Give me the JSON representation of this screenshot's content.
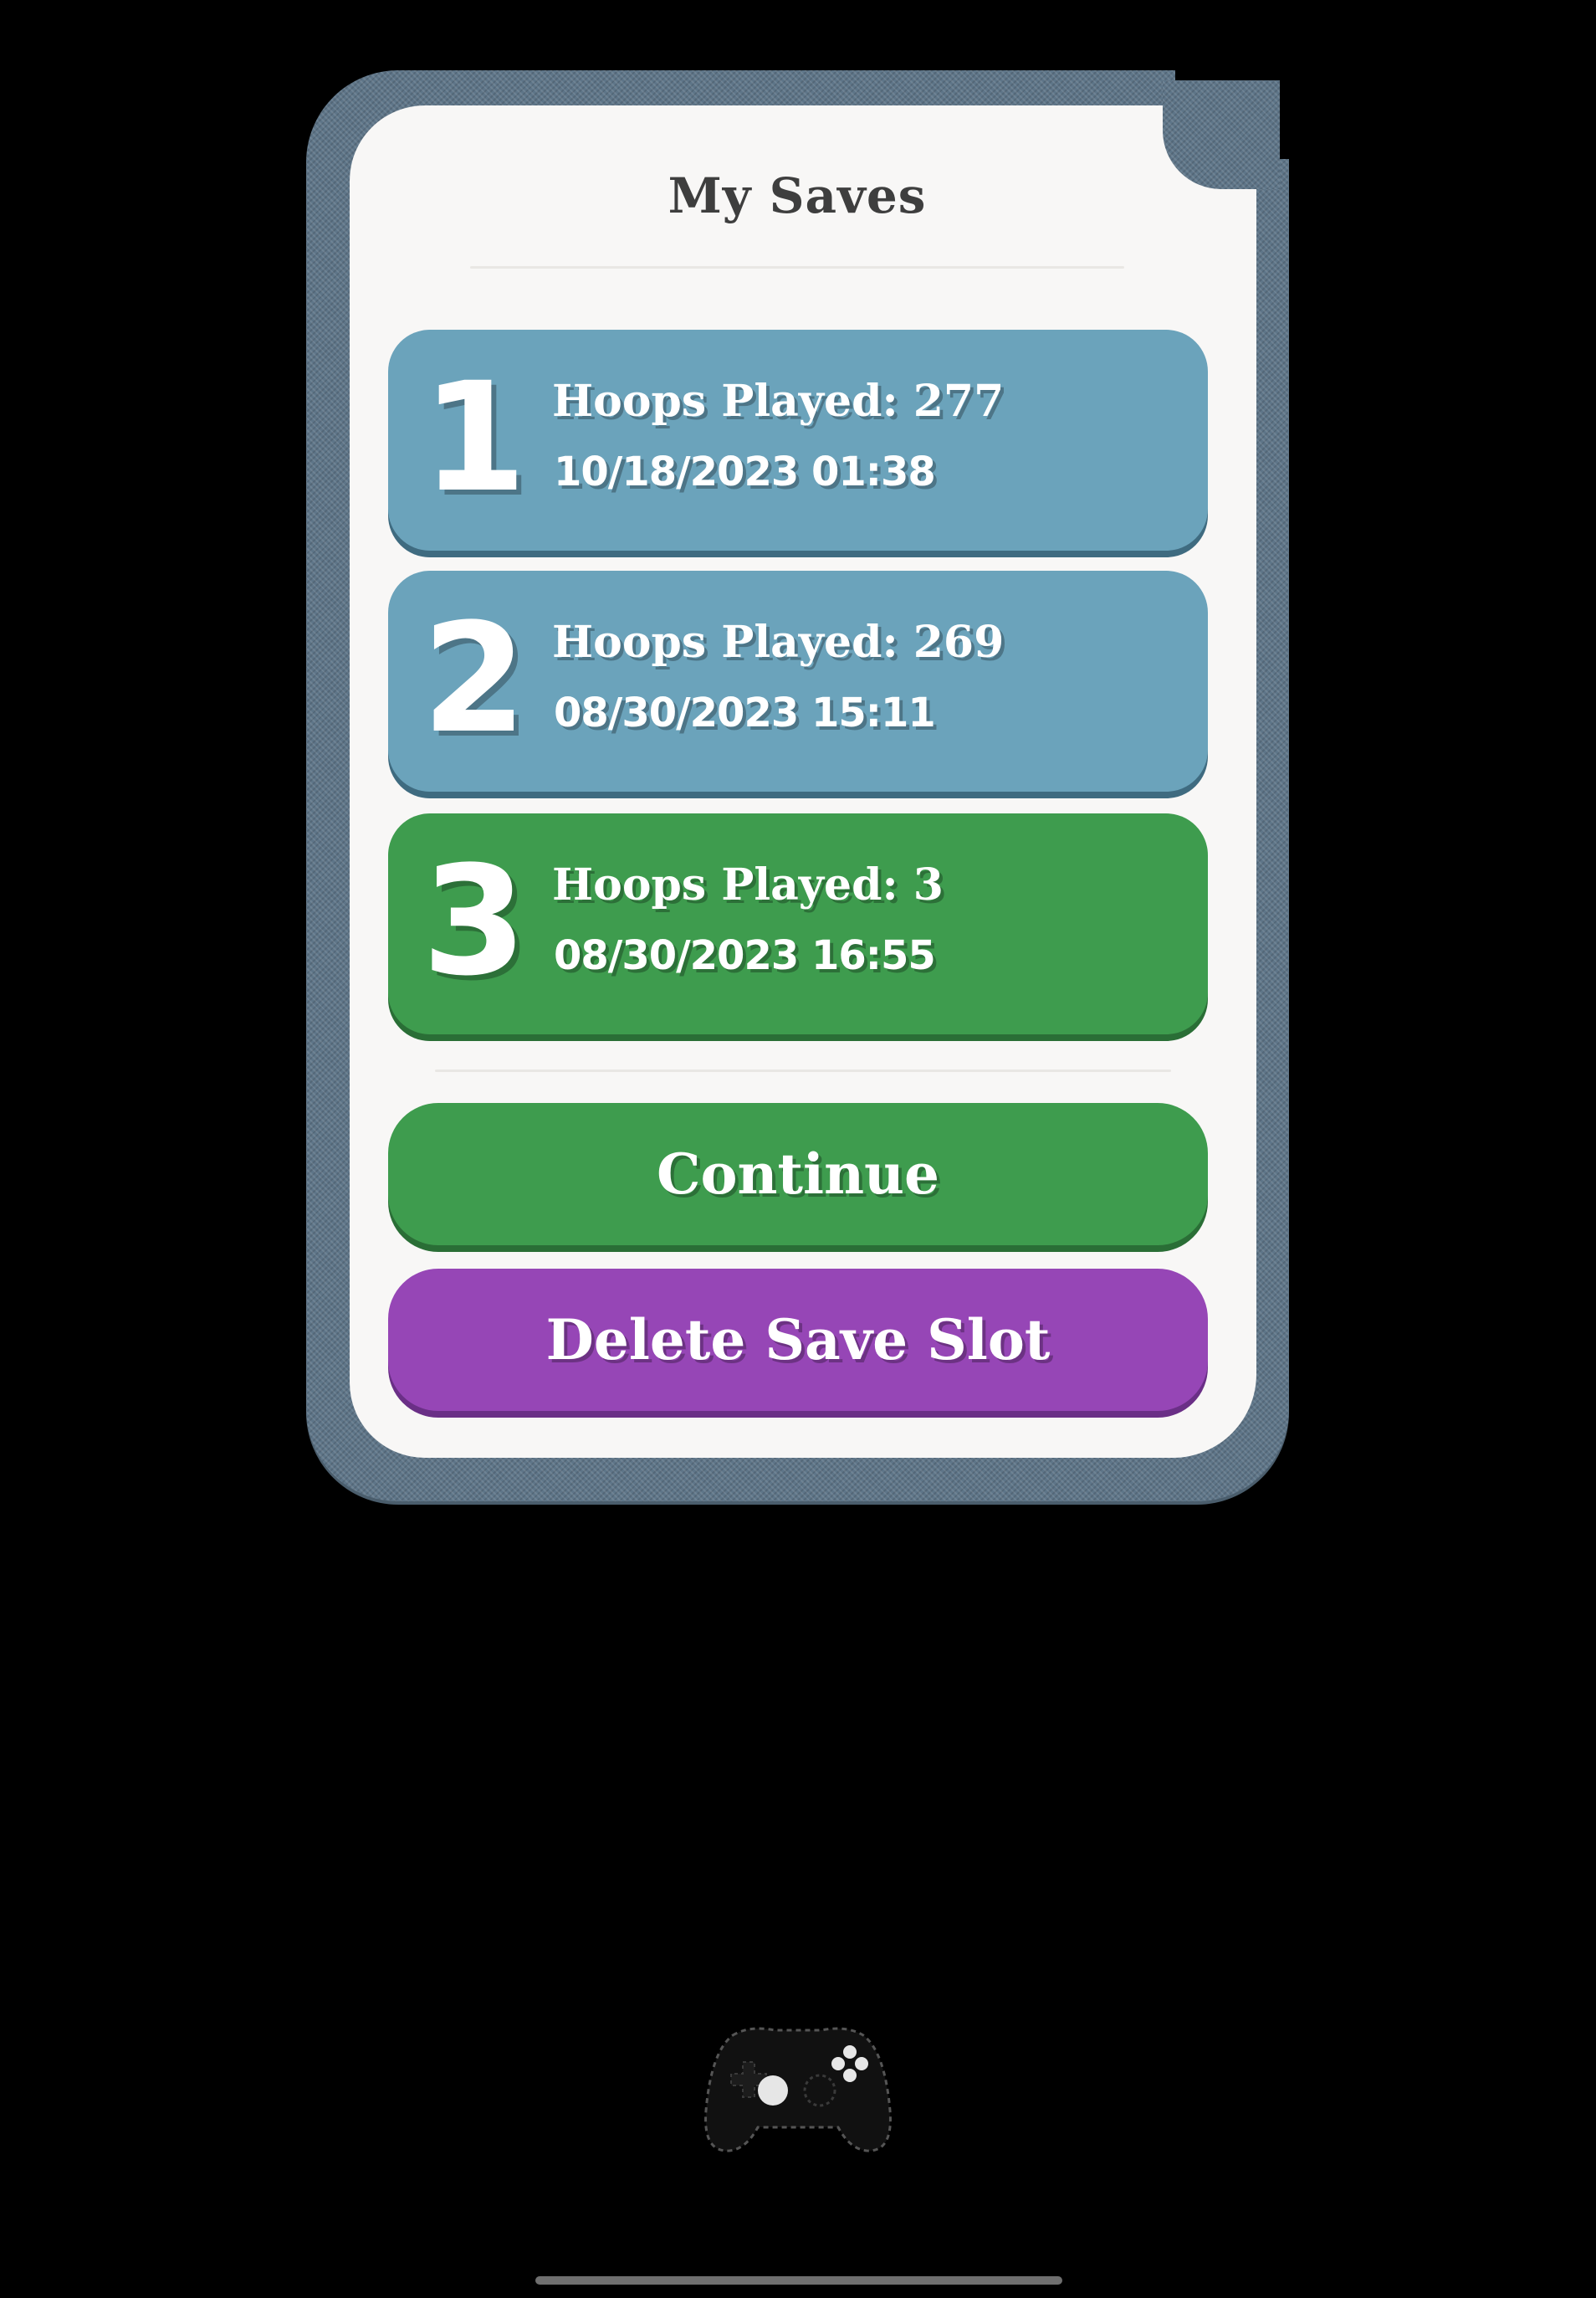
{
  "dialog": {
    "title": "My Saves"
  },
  "slots": [
    {
      "number": "1",
      "hoops": "Hoops Played: 277",
      "date": "10/18/2023 01:38",
      "color": "#6ba3bb"
    },
    {
      "number": "2",
      "hoops": "Hoops Played: 269",
      "date": "08/30/2023 15:11",
      "color": "#6ba3bb"
    },
    {
      "number": "3",
      "hoops": "Hoops Played: 3",
      "date": "08/30/2023 16:55",
      "color": "#3e9c4e"
    }
  ],
  "actions": {
    "continue_label": "Continue",
    "delete_label": "Delete Save Slot"
  },
  "colors": {
    "frame": "#5e7588",
    "panel": "#f8f7f6",
    "slot_blue": "#6ba3bb",
    "green": "#3e9c4e",
    "purple": "#9646b6"
  },
  "icons": {
    "controller": "gamepad-icon"
  }
}
